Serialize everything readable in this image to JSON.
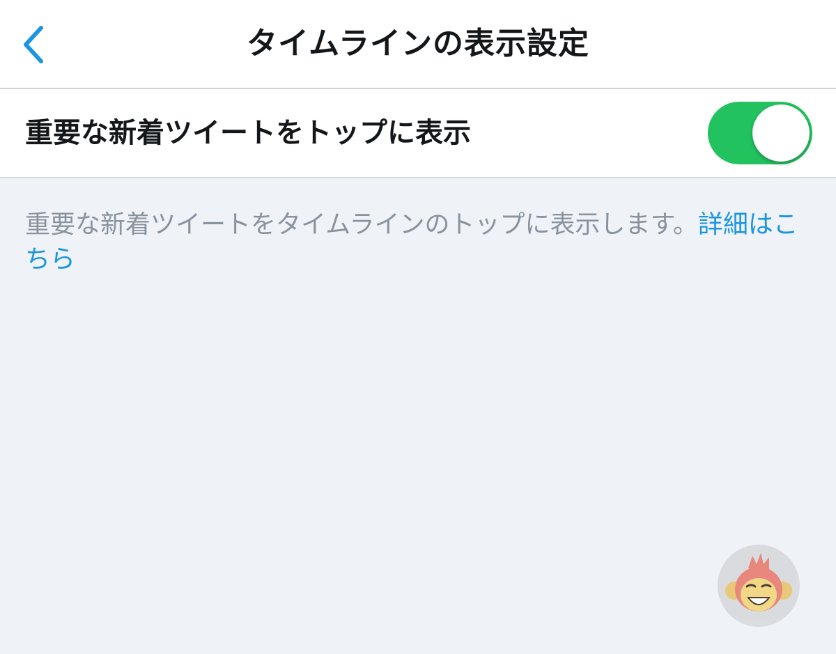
{
  "header": {
    "title": "タイムラインの表示設定",
    "back_icon": "chevron-left-icon"
  },
  "setting": {
    "label": "重要な新着ツイートをトップに表示",
    "toggle_on": true,
    "toggle_color": "#22c35e"
  },
  "description": {
    "text": "重要な新着ツイートをタイムラインのトップに表示します。",
    "link_text": "詳細はこちら",
    "link_color": "#1b95e0"
  },
  "watermark": {
    "icon": "monkey-logo-icon"
  },
  "colors": {
    "accent": "#1b95e0",
    "background": "#eff3f8",
    "text_primary": "#14171a",
    "text_secondary": "#8a939d"
  }
}
